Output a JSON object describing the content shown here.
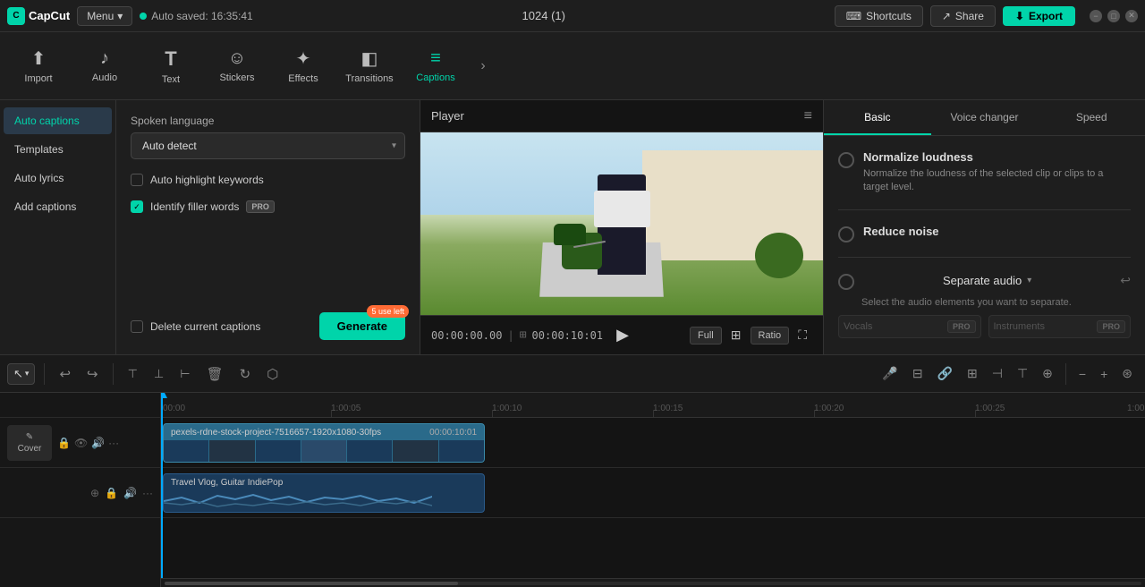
{
  "app": {
    "name": "CapCut",
    "menu_label": "Menu",
    "auto_saved": "Auto saved: 16:35:41",
    "project_title": "1024 (1)"
  },
  "top_bar": {
    "shortcuts_label": "Shortcuts",
    "share_label": "Share",
    "export_label": "Export"
  },
  "toolbar": {
    "items": [
      {
        "id": "import",
        "label": "Import",
        "icon": "⬆"
      },
      {
        "id": "audio",
        "label": "Audio",
        "icon": "♪"
      },
      {
        "id": "text",
        "label": "Text",
        "icon": "T"
      },
      {
        "id": "stickers",
        "label": "Stickers",
        "icon": "⭐"
      },
      {
        "id": "effects",
        "label": "Effects",
        "icon": "✦"
      },
      {
        "id": "transitions",
        "label": "Transitions",
        "icon": "⟷"
      },
      {
        "id": "captions",
        "label": "Captions",
        "icon": "≡"
      }
    ],
    "more_icon": "›"
  },
  "left_panel": {
    "items": [
      {
        "id": "auto-captions",
        "label": "Auto captions",
        "active": true
      },
      {
        "id": "templates",
        "label": "Templates"
      },
      {
        "id": "auto-lyrics",
        "label": "Auto lyrics"
      },
      {
        "id": "add-captions",
        "label": "Add captions"
      }
    ]
  },
  "captions_panel": {
    "spoken_language_label": "Spoken language",
    "auto_detect_label": "Auto detect",
    "auto_highlight_label": "Auto highlight keywords",
    "identify_filler_label": "Identify filler words",
    "pro_badge": "PRO",
    "delete_captions_label": "Delete current captions",
    "generate_label": "Generate",
    "use_left_badge": "5 use left"
  },
  "player": {
    "title": "Player",
    "current_time": "00:00:00.00",
    "total_time": "00:00:10:01",
    "controls": {
      "full_label": "Full",
      "ratio_label": "Ratio"
    }
  },
  "right_panel": {
    "tabs": [
      {
        "id": "basic",
        "label": "Basic",
        "active": true
      },
      {
        "id": "voice-changer",
        "label": "Voice changer"
      },
      {
        "id": "speed",
        "label": "Speed"
      }
    ],
    "normalize_loudness": {
      "label": "Normalize loudness",
      "description": "Normalize the loudness of the selected clip or clips to a target level."
    },
    "reduce_noise": {
      "label": "Reduce noise"
    },
    "separate_audio": {
      "label": "Separate audio",
      "description": "Select the audio elements you want to separate.",
      "vocals_label": "Vocals",
      "instruments_label": "Instruments"
    }
  },
  "timeline": {
    "cover_label": "Cover",
    "cover_icon": "✎",
    "video_clip": {
      "name": "pexels-rdne-stock-project-7516657-1920x1080-30fps",
      "duration": "00:00:10:01"
    },
    "audio_clip": {
      "name": "Travel Vlog, Guitar IndiePop"
    },
    "ruler_marks": [
      "00:00",
      "1:00:05",
      "1:00:10",
      "1:00:15",
      "1:00:20",
      "1:00:25",
      "1:00"
    ]
  },
  "timeline_toolbar": {
    "tools": [
      {
        "id": "select",
        "icon": "↖"
      },
      {
        "id": "undo",
        "icon": "↩"
      },
      {
        "id": "redo",
        "icon": "↪"
      },
      {
        "id": "split",
        "icon": "⬧"
      },
      {
        "id": "split-v",
        "icon": "⟂"
      },
      {
        "id": "split-h",
        "icon": "⟂"
      },
      {
        "id": "delete",
        "icon": "🗑"
      },
      {
        "id": "rotate",
        "icon": "↻"
      },
      {
        "id": "crop",
        "icon": "⬡"
      }
    ],
    "right_tools": [
      {
        "id": "mic",
        "icon": "🎤"
      },
      {
        "id": "link",
        "icon": "🔗"
      },
      {
        "id": "unlink",
        "icon": "⛓"
      },
      {
        "id": "lock",
        "icon": "🔒"
      },
      {
        "id": "split2",
        "icon": "⊟"
      },
      {
        "id": "copy",
        "icon": "⊞"
      },
      {
        "id": "zoom-out",
        "icon": "−"
      },
      {
        "id": "zoom-in",
        "icon": "+"
      },
      {
        "id": "fit",
        "icon": "⊕"
      }
    ]
  }
}
